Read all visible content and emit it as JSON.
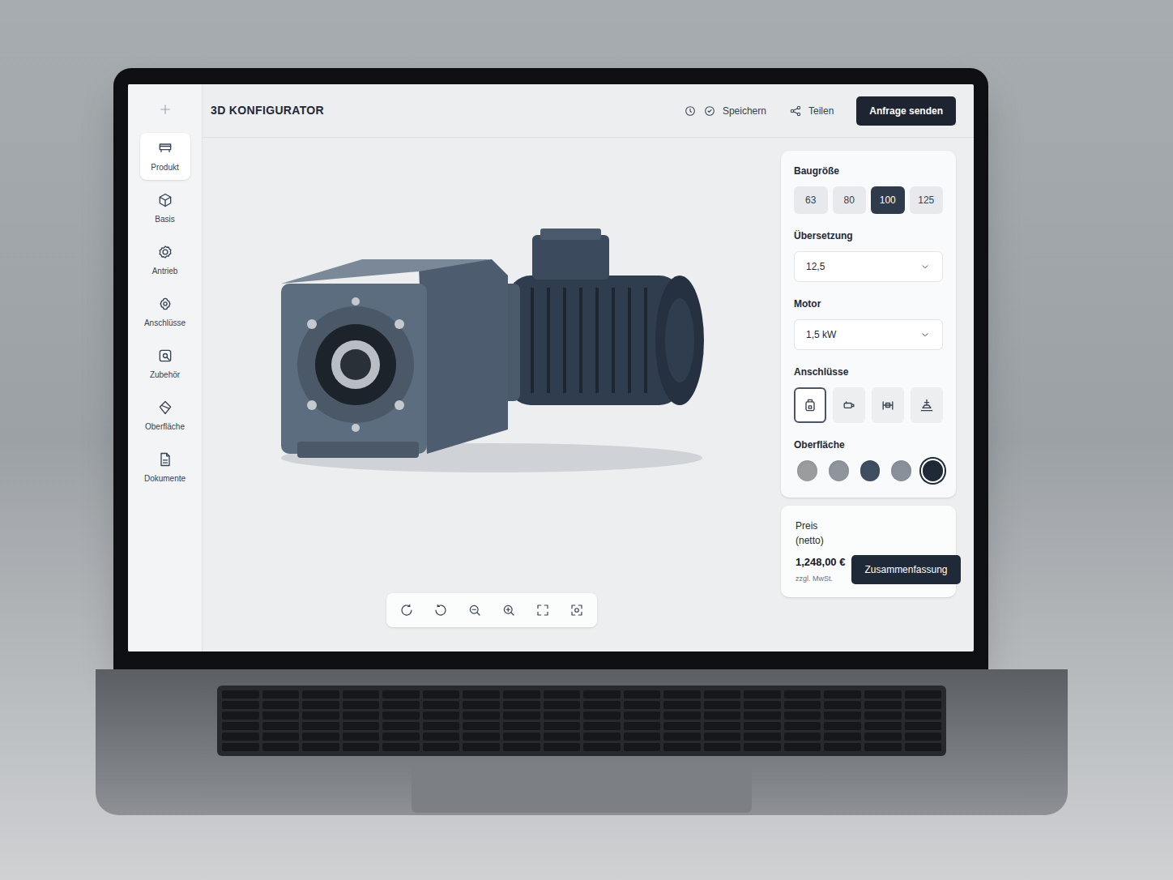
{
  "app": {
    "title": "3D KONFIGURATOR"
  },
  "sidebar": {
    "items": [
      {
        "label": "Produkt",
        "selected": true
      },
      {
        "label": "Basis",
        "selected": false
      },
      {
        "label": "Antrieb",
        "selected": false
      },
      {
        "label": "Anschlüsse",
        "selected": false
      },
      {
        "label": "Zubehör",
        "selected": false
      },
      {
        "label": "Oberfläche",
        "selected": false
      },
      {
        "label": "Dokumente",
        "selected": false
      }
    ]
  },
  "header": {
    "actions": [
      {
        "label": "Speichern"
      },
      {
        "label": "Teilen"
      }
    ],
    "primary": "Anfrage senden"
  },
  "config": {
    "size": {
      "label": "Baugröße",
      "options": [
        {
          "label": "63",
          "selected": false
        },
        {
          "label": "80",
          "selected": false
        },
        {
          "label": "100",
          "selected": true
        },
        {
          "label": "125",
          "selected": false
        }
      ]
    },
    "ratio": {
      "label": "Übersetzung",
      "value": "12,5"
    },
    "motor": {
      "label": "Motor",
      "value": "1,5 kW"
    },
    "connections": {
      "label": "Anschlüsse",
      "options": [
        {
          "selected": true
        },
        {
          "selected": false
        },
        {
          "selected": false
        },
        {
          "selected": false
        }
      ]
    },
    "surface": {
      "label": "Oberfläche",
      "options": [
        {
          "color": "#9a9c9e",
          "selected": false
        },
        {
          "color": "#8e959c",
          "selected": false
        },
        {
          "color": "#3f4e60",
          "selected": false
        },
        {
          "color": "#8a9099",
          "selected": false
        },
        {
          "color": "#1f2a37",
          "selected": true
        }
      ]
    }
  },
  "price": {
    "label": "Preis (netto)",
    "value": "1,248,00 €",
    "note": "zzgl. MwSt.",
    "button": "Zusammenfassung"
  }
}
